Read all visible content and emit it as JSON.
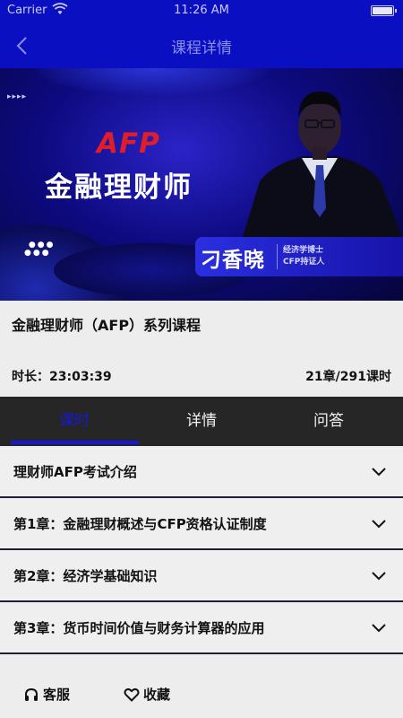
{
  "status_bar": {
    "carrier": "Carrier",
    "time": "11:26 AM",
    "battery_level": 1.0
  },
  "nav": {
    "title": "课程详情",
    "back_icon": "chevron-left-icon"
  },
  "banner": {
    "tag": "AFP",
    "title": "金融理财师",
    "lecturer_name": "刁香晓",
    "lecturer_credentials": [
      "经济学博士",
      "CFP持证人"
    ],
    "arrows": "▸▸▸▸"
  },
  "course": {
    "title": "金融理财师（AFP）系列课程",
    "duration": "时长：23:03:39",
    "chapters": "21章/291课时"
  },
  "tabs": [
    {
      "label": "课时",
      "active": true
    },
    {
      "label": "详情",
      "active": false
    },
    {
      "label": "问答",
      "active": false
    }
  ],
  "chapter_list": [
    {
      "label": "理财师AFP考试介绍"
    },
    {
      "label": "第1章：金融理财概述与CFP资格认证制度"
    },
    {
      "label": "第2章：经济学基础知识"
    },
    {
      "label": "第3章：货币时间价值与财务计算器的应用"
    }
  ],
  "bottom_bar": {
    "service_label": "客服",
    "service_icon": "headset-icon",
    "favorite_label": "收藏",
    "favorite_icon": "heart-icon"
  },
  "colors": {
    "brand": "#0b0fc2",
    "tab_active": "#1718d6",
    "tab_bar": "#262626"
  }
}
